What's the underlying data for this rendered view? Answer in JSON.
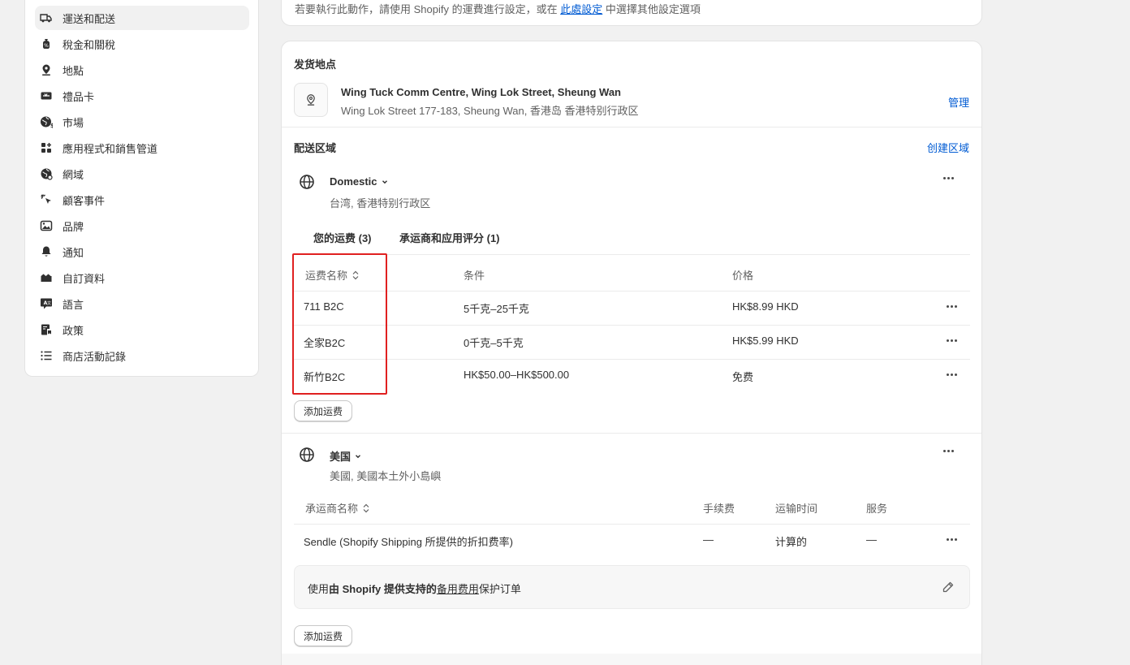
{
  "sidebar": {
    "items": [
      {
        "label": "運送和配送",
        "icon": "truck-icon",
        "active": true
      },
      {
        "label": "稅金和關稅",
        "icon": "tax-bag-icon",
        "active": false
      },
      {
        "label": "地點",
        "icon": "location-pin-icon",
        "active": false
      },
      {
        "label": "禮品卡",
        "icon": "gift-card-icon",
        "active": false
      },
      {
        "label": "市場",
        "icon": "globe-market-icon",
        "active": false
      },
      {
        "label": "應用程式和銷售管道",
        "icon": "apps-icon",
        "active": false
      },
      {
        "label": "網域",
        "icon": "globe-domain-icon",
        "active": false
      },
      {
        "label": "顧客事件",
        "icon": "cursor-click-icon",
        "active": false
      },
      {
        "label": "品牌",
        "icon": "image-brand-icon",
        "active": false
      },
      {
        "label": "通知",
        "icon": "bell-icon",
        "active": false
      },
      {
        "label": "自訂資料",
        "icon": "metafields-icon",
        "active": false
      },
      {
        "label": "語言",
        "icon": "language-icon",
        "active": false
      },
      {
        "label": "政策",
        "icon": "policy-icon",
        "active": false
      },
      {
        "label": "商店活動記錄",
        "icon": "list-icon",
        "active": false
      }
    ]
  },
  "top_card": {
    "text_before": "若要執行此動作，請使用 Shopify 的運費進行設定，或在 ",
    "link_text": "此處設定",
    "text_after": " 中選擇其他設定選項"
  },
  "origin": {
    "title": "发货地点",
    "name": "Wing Tuck Comm Centre, Wing Lok Street, Sheung Wan",
    "address": "Wing Lok Street 177-183, Sheung Wan, 香港岛 香港特别行政区",
    "manage_label": "管理"
  },
  "zones": {
    "title": "配送区域",
    "create_label": "创建区域",
    "domestic": {
      "name": "Domestic",
      "regions": "台湾, 香港特别行政区",
      "tabs": [
        {
          "label": "您的运费 (3)"
        },
        {
          "label": "承运商和应用评分 (1)"
        }
      ],
      "columns": [
        "运费名称",
        "条件",
        "价格"
      ],
      "rates": [
        {
          "name": "711 B2C",
          "condition": "5千克–25千克",
          "price": "HK$8.99 HKD"
        },
        {
          "name": "全家B2C",
          "condition": "0千克–5千克",
          "price": "HK$5.99 HKD"
        },
        {
          "name": "新竹B2C",
          "condition": "HK$50.00–HK$500.00",
          "price": "免费"
        }
      ],
      "add_rate_label": "添加运费"
    },
    "usa": {
      "name": "美国",
      "regions": "美國, 美國本土外小島嶼",
      "columns": [
        "承运商名称",
        "手续费",
        "运输时间",
        "服务"
      ],
      "carriers": [
        {
          "name": "Sendle (Shopify Shipping 所提供的折扣费率)",
          "fee": "—",
          "transit": "计算的",
          "service": "—"
        }
      ],
      "protect": {
        "prefix": "使用",
        "bold": "由 Shopify 提供支持的",
        "link": "备用费用",
        "suffix": "保护订单"
      },
      "add_rate_label": "添加运费"
    }
  }
}
